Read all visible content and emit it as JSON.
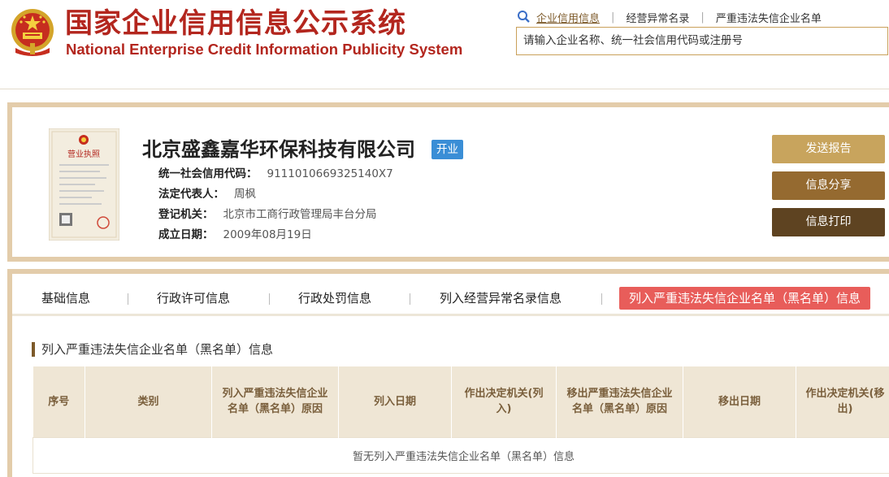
{
  "header": {
    "title_cn": "国家企业信用信息公示系统",
    "title_en": "National Enterprise Credit Information Publicity System",
    "links": [
      {
        "label": "企业信用信息",
        "active": true
      },
      {
        "label": "经营异常名录",
        "active": false
      },
      {
        "label": "严重违法失信企业名单",
        "active": false
      }
    ],
    "search_placeholder": "请输入企业名称、统一社会信用代码或注册号"
  },
  "company": {
    "name": "北京盛鑫嘉华环保科技有限公司",
    "status": "开业",
    "license_title": "营业执照",
    "fields": [
      {
        "label": "统一社会信用代码：",
        "value": "9111010669325140X7"
      },
      {
        "label": "法定代表人：",
        "value": "周枫"
      },
      {
        "label": "登记机关：",
        "value": "北京市工商行政管理局丰台分局"
      },
      {
        "label": "成立日期：",
        "value": "2009年08月19日"
      }
    ]
  },
  "actions": {
    "report": "发送报告",
    "share": "信息分享",
    "print": "信息打印"
  },
  "tabs": [
    {
      "label": "基础信息"
    },
    {
      "label": "行政许可信息"
    },
    {
      "label": "行政处罚信息"
    },
    {
      "label": "列入经营异常名录信息"
    },
    {
      "label": "列入严重违法失信企业名单（黑名单）信息",
      "active": true
    }
  ],
  "section": {
    "title": "列入严重违法失信企业名单（黑名单）信息",
    "columns": [
      "序号",
      "类别",
      "列入严重违法失信企业名单（黑名单）原因",
      "列入日期",
      "作出决定机关(列入)",
      "移出严重违法失信企业名单（黑名单）原因",
      "移出日期",
      "作出决定机关(移出)"
    ],
    "empty_text": "暂无列入严重违法失信企业名单（黑名单）信息"
  },
  "colors": {
    "brand_red": "#b3261e",
    "accent_gold": "#c8a45d",
    "active_tab": "#e85d5a",
    "status_blue": "#3a8ed6"
  }
}
